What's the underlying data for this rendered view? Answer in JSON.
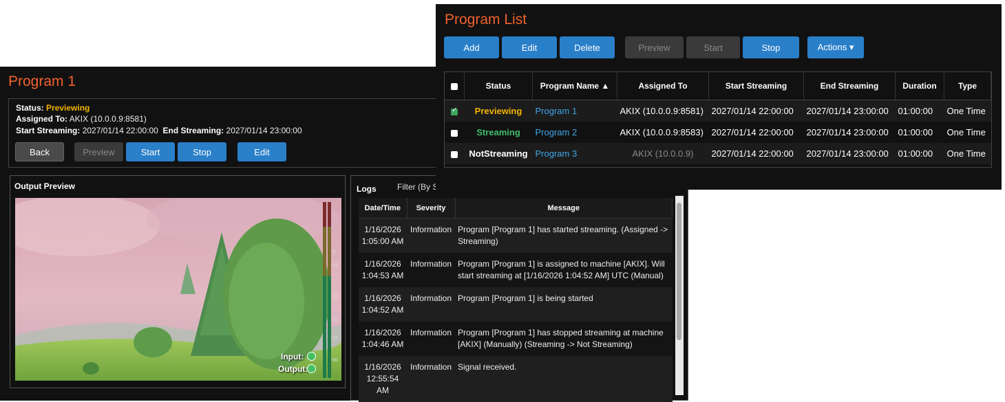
{
  "program1": {
    "title": "Program 1",
    "status_label": "Status:",
    "status_value": "Previewing",
    "assigned_label": "Assigned To:",
    "assigned_value": "AKIX (10.0.0.9:8581)",
    "start_label": "Start Streaming:",
    "start_value": "2027/01/14 22:00:00",
    "end_label": "End Streaming:",
    "end_value": "2027/01/14 23:00:00",
    "buttons": {
      "back": "Back",
      "preview": "Preview",
      "start": "Start",
      "stop": "Stop",
      "edit": "Edit"
    },
    "output_preview_title": "Output Preview",
    "meter_ticks": [
      "-6",
      "-10",
      "-16",
      "-22",
      "-32",
      "-60"
    ],
    "input_label": "Input:",
    "output_label": "Output:",
    "logs": {
      "title": "Logs",
      "filter_label": "Filter (By S",
      "columns": [
        "Date/Time",
        "Severity",
        "Message"
      ],
      "rows": [
        {
          "date": "1/16/2026",
          "time": "1:05:00 AM",
          "severity": "Information",
          "message": "Program [Program 1] has started streaming. (Assigned -> Streaming)"
        },
        {
          "date": "1/16/2026",
          "time": "1:04:53 AM",
          "severity": "Information",
          "message": "Program [Program 1] is assigned to machine [AKIX]. Will start streaming at [1/16/2026 1:04:52 AM] UTC (Manual)"
        },
        {
          "date": "1/16/2026",
          "time": "1:04:52 AM",
          "severity": "Information",
          "message": "Program [Program 1] is being started"
        },
        {
          "date": "1/16/2026",
          "time": "1:04:46 AM",
          "severity": "Information",
          "message": "Program [Program 1] has stopped streaming at machine [AKIX] (Manually) (Streaming -> Not Streaming)"
        },
        {
          "date": "1/16/2026",
          "time": "12:55:54 AM",
          "severity": "Information",
          "message": "Signal received."
        }
      ]
    }
  },
  "program_list": {
    "title": "Program List",
    "buttons": {
      "add": "Add",
      "edit": "Edit",
      "delete": "Delete",
      "preview": "Preview",
      "start": "Start",
      "stop": "Stop",
      "actions": "Actions ▾"
    },
    "columns": [
      "Status",
      "Program Name ▲",
      "Assigned To",
      "Start Streaming",
      "End Streaming",
      "Duration",
      "Type"
    ],
    "rows": [
      {
        "checked": true,
        "status": "Previewing",
        "status_color": "#f4b400",
        "name": "Program 1",
        "assigned": "AKIX (10.0.0.9:8581)",
        "start": "2027/01/14 22:00:00",
        "end": "2027/01/14 23:00:00",
        "duration": "01:00:00",
        "type": "One Time"
      },
      {
        "checked": false,
        "status": "Streaming",
        "status_color": "#3fbf6a",
        "name": "Program 2",
        "assigned": "AKIX (10.0.0.9:8583)",
        "start": "2027/01/14 22:00:00",
        "end": "2027/01/14 23:00:00",
        "duration": "01:00:00",
        "type": "One Time"
      },
      {
        "checked": false,
        "status": "NotStreaming",
        "status_color": "#ffffff",
        "name": "Program 3",
        "assigned": "AKIX (10.0.0.9)",
        "start": "2027/01/14 22:00:00",
        "end": "2027/01/14 23:00:00",
        "duration": "01:00:00",
        "type": "One Time"
      }
    ]
  },
  "colors": {
    "accent_orange": "#f2622e",
    "button_blue": "#2a7fc9",
    "previewing": "#f4b400",
    "streaming": "#3fbf6a",
    "link": "#3ea6e8"
  }
}
